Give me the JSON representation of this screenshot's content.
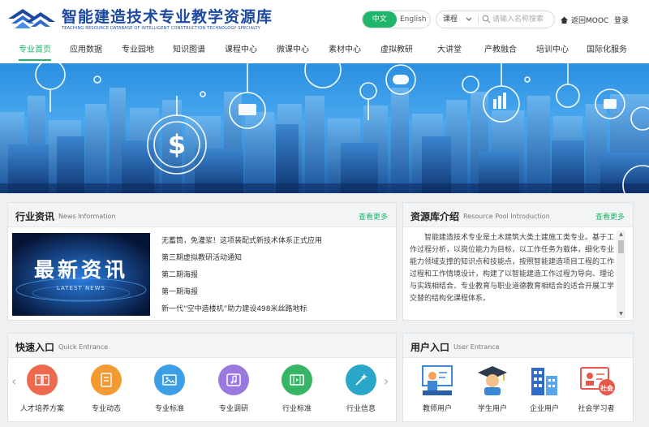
{
  "header": {
    "title": "智能建造技术专业教学资源库",
    "subtitle": "TEACHING RESOURCE DATABASE OF INTELLIGENT CONSTRUCTION TECHNOLOGY SPECIALTY",
    "lang_cn": "中文",
    "lang_en": "English",
    "search_category": "课程",
    "search_placeholder": "请输入名称搜索",
    "mooc_label": "返回MOOC",
    "login_label": "登录"
  },
  "nav": [
    "专业首页",
    "应用数据",
    "专业园地",
    "知识图谱",
    "课程中心",
    "微课中心",
    "素材中心",
    "虚拟教研",
    "大讲堂",
    "产教融合",
    "培训中心",
    "国际化服务"
  ],
  "news": {
    "title": "行业资讯",
    "title_en": "News Information",
    "more": "查看更多",
    "image_text": "最新资讯",
    "image_text_en": "LATEST NEWS",
    "items": [
      "无蓄筒，免灌浆！这项装配式新技术体系正式应用",
      "第三期虚拟教研活动通知",
      "第二期海报",
      "第一期海报",
      "新一代“空中造楼机”助力建设498米丝路地标"
    ]
  },
  "intro": {
    "title": "资源库介绍",
    "title_en": "Resource Pool Introduction",
    "more": "查看更多",
    "text": "智能建造技术专业是土木建筑大类土建施工类专业。基于工作过程分析，以岗位能力为目标，以工作任务为载体，细化专业能力领域支撑的知识点和技能点，按照智能建造项目工程的工作过程和工作情境设计，构建了以智能建造工作过程为导向、理论与实践相结合、专业教育与职业道德教育相结合的适合开展工学交替的结构化课程体系。"
  },
  "quick": {
    "title": "快速入口",
    "title_en": "Quick Entrance",
    "items": [
      {
        "label": "人才培养方案",
        "icon": "book-icon",
        "color": "#ee6a4e"
      },
      {
        "label": "专业动态",
        "icon": "document-icon",
        "color": "#f59a33"
      },
      {
        "label": "专业标准",
        "icon": "image-icon",
        "color": "#3d9ee6"
      },
      {
        "label": "专业调研",
        "icon": "music-icon",
        "color": "#9a78e0"
      },
      {
        "label": "行业标准",
        "icon": "film-icon",
        "color": "#37b566"
      },
      {
        "label": "行业信息",
        "icon": "magic-icon",
        "color": "#2aa7c8"
      }
    ]
  },
  "users": {
    "title": "用户入口",
    "title_en": "User Entrance",
    "items": [
      {
        "label": "教师用户",
        "icon": "teacher-icon"
      },
      {
        "label": "学生用户",
        "icon": "student-icon"
      },
      {
        "label": "企业用户",
        "icon": "enterprise-icon"
      },
      {
        "label": "社会学习者",
        "icon": "social-learner-icon",
        "badge": "社会"
      }
    ]
  }
}
